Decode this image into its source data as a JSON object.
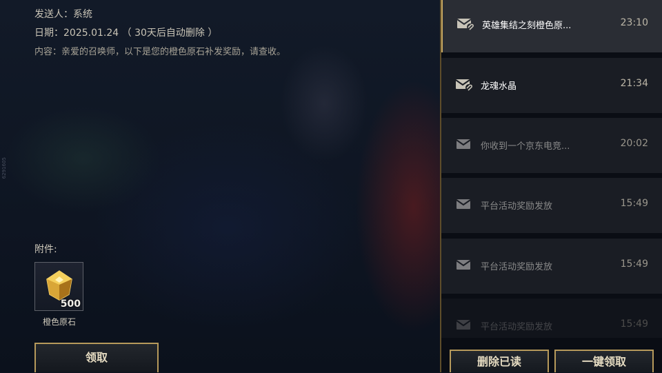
{
  "mail": {
    "sender_label": "发送人：",
    "sender": "系统",
    "date_label": "日期：",
    "date": "2025.01.24",
    "expiry": "（ 30天后自动删除 ）",
    "content_label": "内容：",
    "content": "亲爱的召唤师，以下是您的橙色原石补发奖励，请查收。"
  },
  "attachments": {
    "label": "附件:",
    "items": [
      {
        "name": "橙色原石",
        "qty": "500",
        "icon": "orange-gem-icon"
      }
    ],
    "claim_label": "领取"
  },
  "side_code": "6291605",
  "mail_list": [
    {
      "subject": "英雄集结之刻橙色原...",
      "time": "23:10",
      "icon": "mail-attachment-icon",
      "state": "selected"
    },
    {
      "subject": "龙魂水晶",
      "time": "21:34",
      "icon": "mail-attachment-icon",
      "state": "unread"
    },
    {
      "subject": "你收到一个京东电竞...",
      "time": "20:02",
      "icon": "mail-icon",
      "state": "read"
    },
    {
      "subject": "平台活动奖励发放",
      "time": "15:49",
      "icon": "mail-icon",
      "state": "read"
    },
    {
      "subject": "平台活动奖励发放",
      "time": "15:49",
      "icon": "mail-icon",
      "state": "read"
    },
    {
      "subject": "平台活动奖励发放",
      "time": "15:49",
      "icon": "mail-icon",
      "state": "read"
    }
  ],
  "actions": {
    "delete_read": "删除已读",
    "claim_all": "一键领取"
  },
  "colors": {
    "accent_gold": "#b79a5b",
    "selected_bar": "#c9a961",
    "panel_bg": "#0a0d14"
  }
}
